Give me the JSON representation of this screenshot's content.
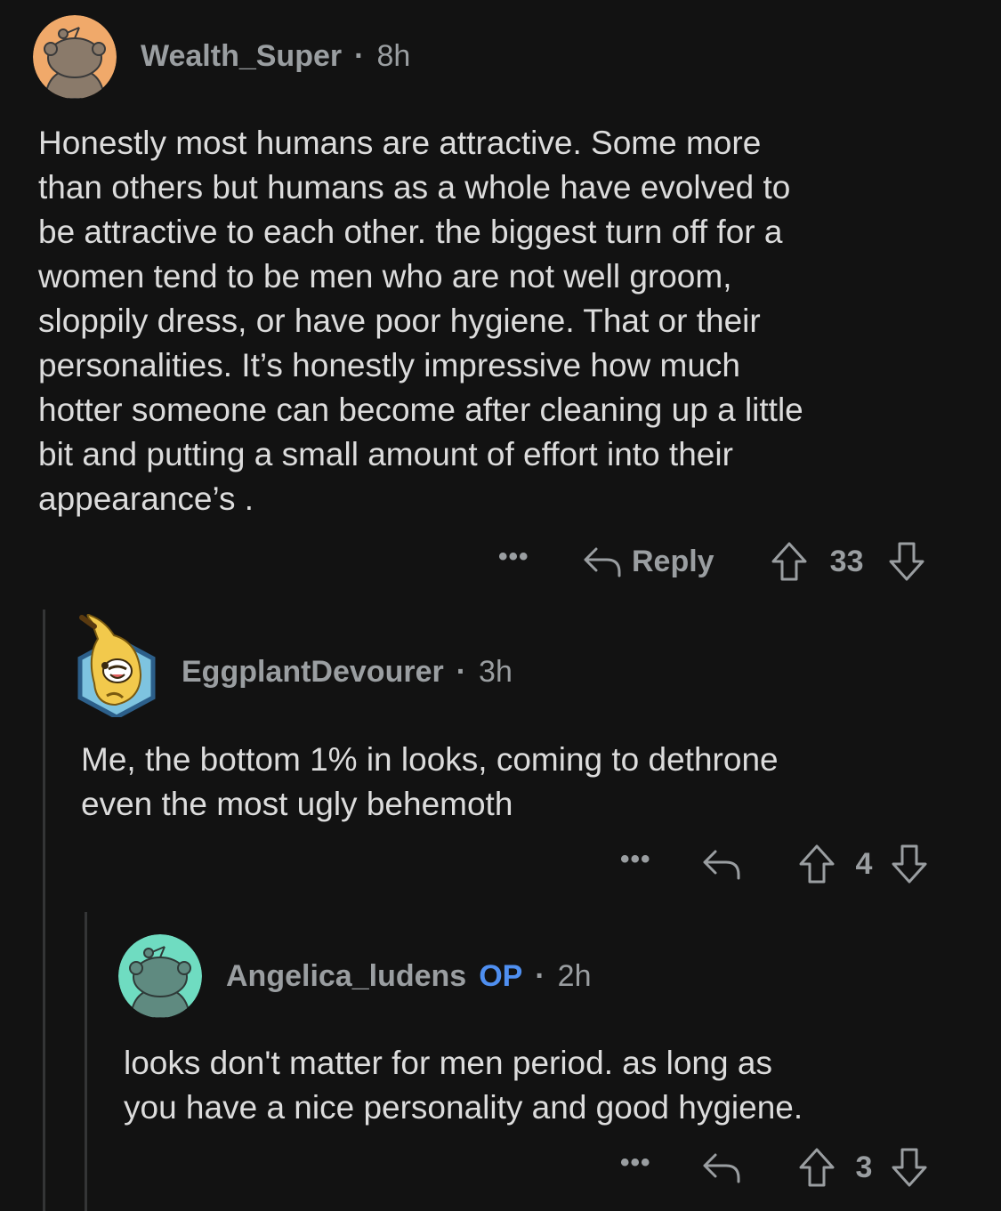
{
  "comments": [
    {
      "username": "Wealth_Super",
      "separator": "·",
      "time": "8h",
      "avatar_color": "#f0a96a",
      "avatar_icon": "snoo-avatar",
      "lines": [
        "Honestly most humans are attractive. Some more",
        "than others but humans as a whole have evolved to",
        "be attractive to each other. the biggest turn off for a",
        "women tend to be men who are not well groom,",
        "sloppily dress, or have poor hygiene. That or their",
        "personalities. It’s honestly impressive how much",
        "hotter someone can become after cleaning up a little",
        "bit and putting a small amount of effort into their",
        "appearance’s ."
      ],
      "more_label": "•••",
      "reply_label": "Reply",
      "votes": "33"
    },
    {
      "username": "EggplantDevourer",
      "separator": "·",
      "time": "3h",
      "avatar_icon": "banana-character-avatar",
      "lines": [
        "Me, the bottom 1% in looks, coming to dethrone",
        "even the most ugly behemoth"
      ],
      "more_label": "•••",
      "votes": "4"
    },
    {
      "username": "Angelica_ludens",
      "op_label": "OP",
      "separator": "·",
      "time": "2h",
      "avatar_color": "#6fdcc1",
      "avatar_icon": "snoo-avatar",
      "lines": [
        "looks don't matter for men period. as long as",
        "you have a nice personality and good hygiene."
      ],
      "more_label": "•••",
      "votes": "3"
    }
  ],
  "colors": {
    "background": "#121212",
    "meta_text": "#9a9ea1",
    "body_text": "#dcdcdc",
    "op_badge": "#4f8ff0",
    "thread_line": "#343536"
  }
}
